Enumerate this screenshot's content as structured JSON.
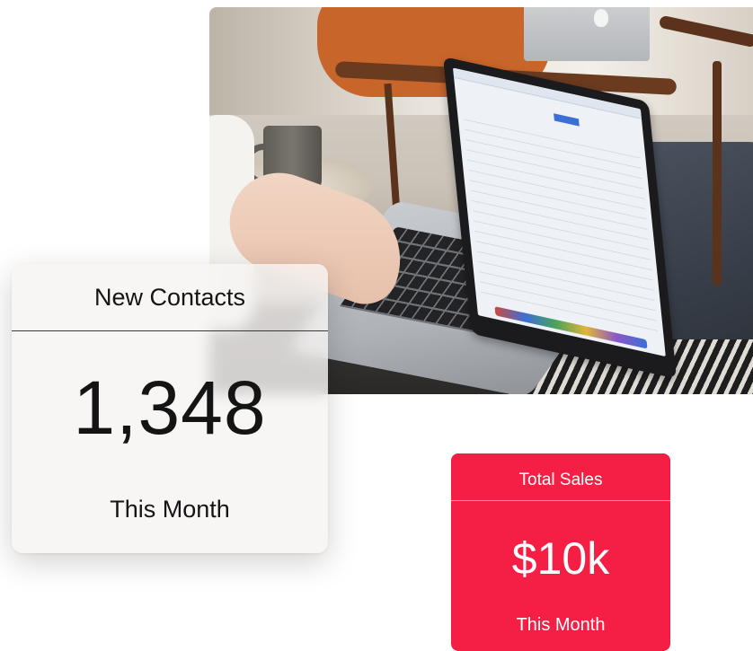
{
  "photo": {
    "description_icon": "laptop-photo"
  },
  "contacts_card": {
    "title": "New Contacts",
    "value": "1,348",
    "period": "This Month"
  },
  "sales_card": {
    "title": "Total Sales",
    "value": "$10k",
    "period": "This Month",
    "color": "#f51f45"
  }
}
